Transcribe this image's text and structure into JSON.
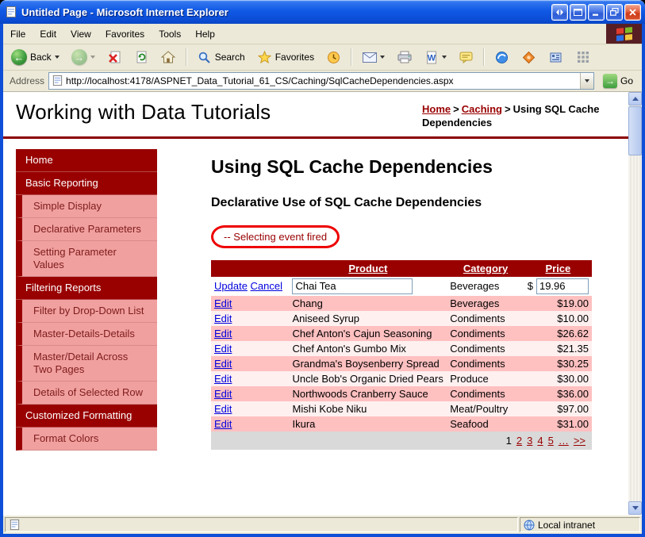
{
  "window": {
    "title": "Untitled Page - Microsoft Internet Explorer"
  },
  "menubar": {
    "items": [
      "File",
      "Edit",
      "View",
      "Favorites",
      "Tools",
      "Help"
    ]
  },
  "toolbar": {
    "back": "Back",
    "search": "Search",
    "favorites": "Favorites"
  },
  "addressbar": {
    "label": "Address",
    "url": "http://localhost:4178/ASPNET_Data_Tutorial_61_CS/Caching/SqlCacheDependencies.aspx",
    "go": "Go"
  },
  "header": {
    "site_title": "Working with Data Tutorials",
    "breadcrumb": {
      "home": "Home",
      "section": "Caching",
      "current": "Using SQL Cache Dependencies",
      "separator": ">"
    }
  },
  "sidebar": {
    "items": [
      {
        "label": "Home",
        "type": "section"
      },
      {
        "label": "Basic Reporting",
        "type": "section"
      },
      {
        "label": "Simple Display",
        "type": "sub"
      },
      {
        "label": "Declarative Parameters",
        "type": "sub"
      },
      {
        "label": "Setting Parameter Values",
        "type": "sub"
      },
      {
        "label": "Filtering Reports",
        "type": "section"
      },
      {
        "label": "Filter by Drop-Down List",
        "type": "sub"
      },
      {
        "label": "Master-Details-Details",
        "type": "sub"
      },
      {
        "label": "Master/Detail Across Two Pages",
        "type": "sub"
      },
      {
        "label": "Details of Selected Row",
        "type": "sub"
      },
      {
        "label": "Customized Formatting",
        "type": "section"
      },
      {
        "label": "Format Colors",
        "type": "sub"
      }
    ]
  },
  "content": {
    "title": "Using SQL Cache Dependencies",
    "subtitle": "Declarative Use of SQL Cache Dependencies",
    "status_message": "-- Selecting event fired",
    "grid": {
      "columns": {
        "product": "Product",
        "category": "Category",
        "price": "Price"
      },
      "edit_row": {
        "update": "Update",
        "cancel": "Cancel",
        "product": "Chai Tea",
        "category": "Beverages",
        "currency": "$",
        "price": "19.96"
      },
      "rows": [
        {
          "edit": "Edit",
          "product": "Chang",
          "category": "Beverages",
          "price": "$19.00"
        },
        {
          "edit": "Edit",
          "product": "Aniseed Syrup",
          "category": "Condiments",
          "price": "$10.00"
        },
        {
          "edit": "Edit",
          "product": "Chef Anton's Cajun Seasoning",
          "category": "Condiments",
          "price": "$26.62"
        },
        {
          "edit": "Edit",
          "product": "Chef Anton's Gumbo Mix",
          "category": "Condiments",
          "price": "$21.35"
        },
        {
          "edit": "Edit",
          "product": "Grandma's Boysenberry Spread",
          "category": "Condiments",
          "price": "$30.25"
        },
        {
          "edit": "Edit",
          "product": "Uncle Bob's Organic Dried Pears",
          "category": "Produce",
          "price": "$30.00"
        },
        {
          "edit": "Edit",
          "product": "Northwoods Cranberry Sauce",
          "category": "Condiments",
          "price": "$36.00"
        },
        {
          "edit": "Edit",
          "product": "Mishi Kobe Niku",
          "category": "Meat/Poultry",
          "price": "$97.00"
        },
        {
          "edit": "Edit",
          "product": "Ikura",
          "category": "Seafood",
          "price": "$31.00"
        }
      ],
      "pager": {
        "current": "1",
        "pages": [
          "2",
          "3",
          "4",
          "5",
          "…",
          ">>"
        ]
      }
    }
  },
  "statusbar": {
    "zone": "Local intranet"
  },
  "colors": {
    "maroon": "#990000",
    "sidebar_pink": "#F1A0A0",
    "row_pink": "#FFC0C0",
    "row_light": "#FFF0F0",
    "annotation_red": "#EE0000",
    "link_blue": "#0000DD",
    "titlebar_blue": "#1059E6"
  },
  "icons": {
    "back": "green-circle-left-arrow",
    "forward": "green-circle-right-arrow",
    "stop": "red-x-page",
    "refresh": "green-refresh-page",
    "home": "house",
    "search": "magnifier",
    "favorites": "star",
    "history": "clock",
    "mail": "envelope",
    "print": "printer",
    "edit_word": "word-w",
    "discuss": "speech-note",
    "go": "green-arrow",
    "zone": "globe-monitor"
  }
}
